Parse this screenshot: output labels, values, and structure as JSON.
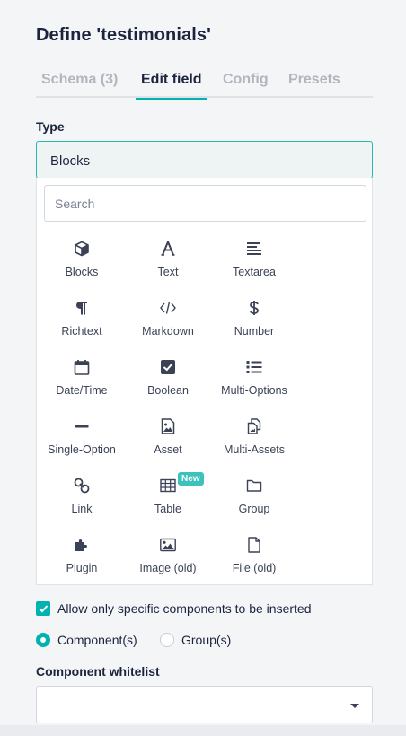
{
  "header": {
    "title": "Define 'testimonials'"
  },
  "tabs": [
    {
      "label": "Schema (3)",
      "active": false
    },
    {
      "label": "Edit field",
      "active": true
    },
    {
      "label": "Config",
      "active": false
    },
    {
      "label": "Presets",
      "active": false
    }
  ],
  "type_field": {
    "label": "Type",
    "selected": "Blocks",
    "search_placeholder": "Search"
  },
  "field_types": [
    {
      "label": "Blocks",
      "icon": "cube-icon"
    },
    {
      "label": "Text",
      "icon": "text-a-icon"
    },
    {
      "label": "Textarea",
      "icon": "align-left-icon"
    },
    {
      "label": "Richtext",
      "icon": "paragraph-icon"
    },
    {
      "label": "Markdown",
      "icon": "code-icon"
    },
    {
      "label": "Number",
      "icon": "dollar-icon"
    },
    {
      "label": "Date/Time",
      "icon": "calendar-icon"
    },
    {
      "label": "Boolean",
      "icon": "checkbox-icon"
    },
    {
      "label": "Multi-Options",
      "icon": "list-icon"
    },
    {
      "label": "Single-Option",
      "icon": "minus-icon"
    },
    {
      "label": "Asset",
      "icon": "image-file-icon"
    },
    {
      "label": "Multi-Assets",
      "icon": "multi-files-icon"
    },
    {
      "label": "Link",
      "icon": "link-icon"
    },
    {
      "label": "Table",
      "icon": "table-icon",
      "badge": "New"
    },
    {
      "label": "Group",
      "icon": "folder-icon"
    },
    {
      "label": "Plugin",
      "icon": "puzzle-icon"
    },
    {
      "label": "Image (old)",
      "icon": "image-icon"
    },
    {
      "label": "File (old)",
      "icon": "file-icon"
    }
  ],
  "options": {
    "restrict_label": "Allow only specific components to be inserted",
    "restrict_checked": true,
    "radio_component": "Component(s)",
    "radio_group": "Group(s)",
    "selected_radio": "Component(s)"
  },
  "whitelist": {
    "label": "Component whitelist",
    "value": ""
  },
  "colors": {
    "accent": "#00b3b0",
    "text": "#1b243f",
    "muted": "#b1b5be",
    "badge": "#3dc1bc"
  }
}
